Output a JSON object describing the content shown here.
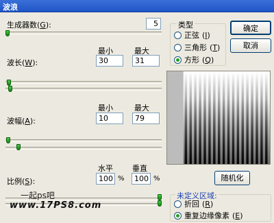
{
  "window": {
    "title": "波浪"
  },
  "generators": {
    "label": "生成器数",
    "key": "G",
    "value": "5",
    "level": 0.0
  },
  "wavelength": {
    "label": "波长",
    "key": "W",
    "min_header": "最小",
    "max_header": "最大",
    "min": "30",
    "max": "31"
  },
  "amplitude": {
    "label": "波幅",
    "key": "A",
    "min_header": "最小",
    "max_header": "最大",
    "min": "10",
    "max": "79"
  },
  "scale": {
    "label": "比例",
    "key": "S",
    "h_header": "水平",
    "v_header": "垂直",
    "h": "100",
    "v": "100",
    "unit": "%"
  },
  "type_group": {
    "title": "类型",
    "options": [
      {
        "label": "正弦",
        "key": "I",
        "selected": false
      },
      {
        "label": "三角形",
        "key": "T",
        "selected": false
      },
      {
        "label": "方形",
        "key": "Q",
        "selected": true
      }
    ]
  },
  "buttons": {
    "ok": "确定",
    "cancel": "取消",
    "randomize": "随机化"
  },
  "undefined_area": {
    "title": "未定义区域:",
    "options": [
      {
        "label": "折回",
        "key": "R",
        "selected": false
      },
      {
        "label": "重复边缘像素",
        "key": "E",
        "selected": true
      }
    ]
  },
  "watermark": {
    "line1": "一起ps吧",
    "line2": "www.17PS8.com"
  },
  "colors": {
    "title_bar": "#2a5fcf",
    "slider_thumb": "#1f9b1f",
    "radio_dot": "#21a121"
  }
}
